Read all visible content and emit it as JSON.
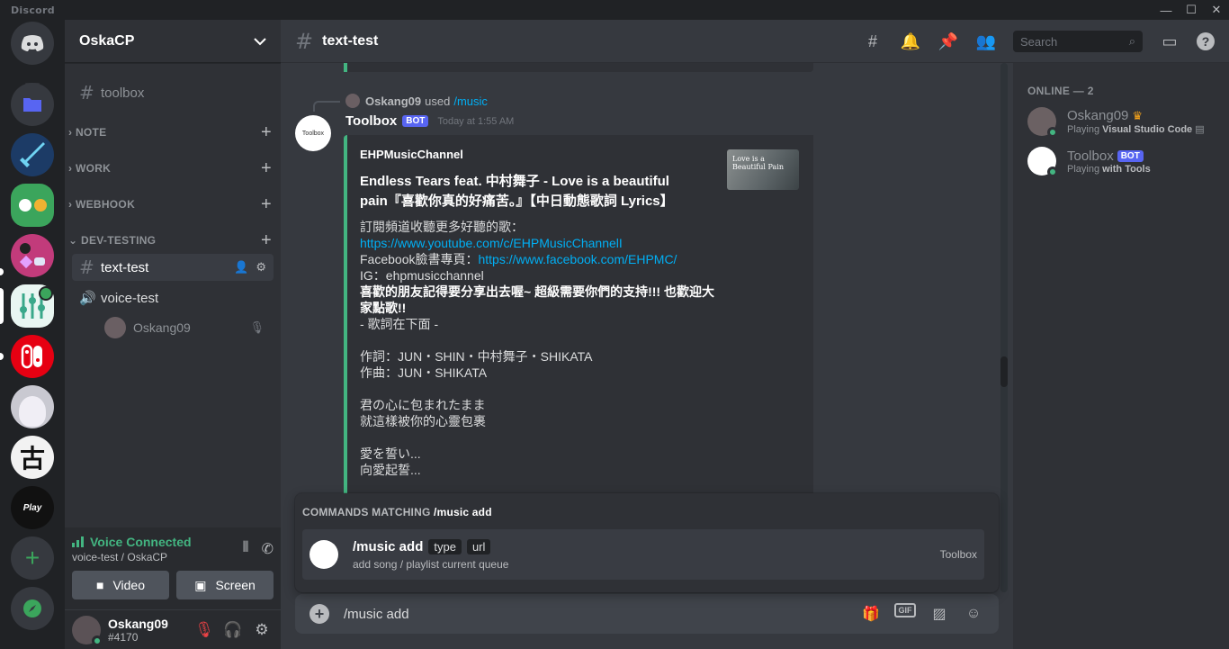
{
  "app": {
    "brand": "Discord"
  },
  "window": {
    "minimize": "—",
    "maximize": "☐",
    "close": "✕"
  },
  "guild": {
    "name": "OskaCP"
  },
  "channels": {
    "toolbox": "toolbox",
    "categories": [
      "NOTE",
      "WORK",
      "WEBHOOK",
      "DEV-TESTING"
    ],
    "text_test": "text-test",
    "voice_test": "voice-test",
    "voice_user": "Oskang09"
  },
  "voice_panel": {
    "status": "Voice Connected",
    "location": "voice-test / OskaCP",
    "video_label": "Video",
    "screen_label": "Screen"
  },
  "user_panel": {
    "name": "Oskang09",
    "tag": "#4170"
  },
  "header": {
    "channel": "text-test",
    "search_placeholder": "Search"
  },
  "message": {
    "reply_user": "Oskang09",
    "reply_used": "used",
    "reply_command": "/music",
    "author": "Toolbox",
    "bot_tag": "BOT",
    "timestamp": "Today at 1:55 AM",
    "avatar_text": "Toolbox"
  },
  "embed": {
    "author": "EHPMusicChannel",
    "title": "Endless Tears feat. 中村舞子 - Love is a beautiful pain『喜歡你真的好痛苦。』【中日動態歌詞 Lyrics】",
    "line1": "訂閱頻道收聽更多好聽的歌：",
    "link1": "https://www.youtube.com/c/EHPMusicChannelI",
    "fb_label": "Facebook臉書專頁：",
    "link2": "https://www.facebook.com/EHPMC/",
    "ig": "IG：ehpmusicchannel",
    "bold_line": "喜歡的朋友記得要分享出去喔~ 超級需要你們的支持!!! 也歡迎大家點歌!!",
    "line2": "- 歌詞在下面 -",
    "lyricist": "作詞：JUN・SHIN・中村舞子・SHIKATA",
    "composer": "作曲：JUN・SHIKATA",
    "lyric1": "君の心に包まれたまま",
    "lyric2": "就這樣被你的心靈包裹",
    "lyric3": "愛を誓い...",
    "lyric4": "向愛起誓...",
    "thumb_title": "Love is a Beautiful Pain"
  },
  "autocomplete": {
    "label": "COMMANDS MATCHING",
    "query": "/music add",
    "command": "/music add",
    "opt1": "type",
    "opt2": "url",
    "description": "add song / playlist current queue",
    "source": "Toolbox"
  },
  "composer": {
    "text": "/music add",
    "gif_label": "GIF"
  },
  "members": {
    "heading": "ONLINE — 2",
    "list": [
      {
        "name": "Oskang09",
        "activity_prefix": "Playing",
        "activity": "Visual Studio Code"
      },
      {
        "name": "Toolbox",
        "bot": "BOT",
        "activity_prefix": "Playing",
        "activity": "with Tools"
      }
    ]
  },
  "colors": {
    "online": "#43b581",
    "blurple": "#5865f2",
    "link": "#00aff4"
  }
}
